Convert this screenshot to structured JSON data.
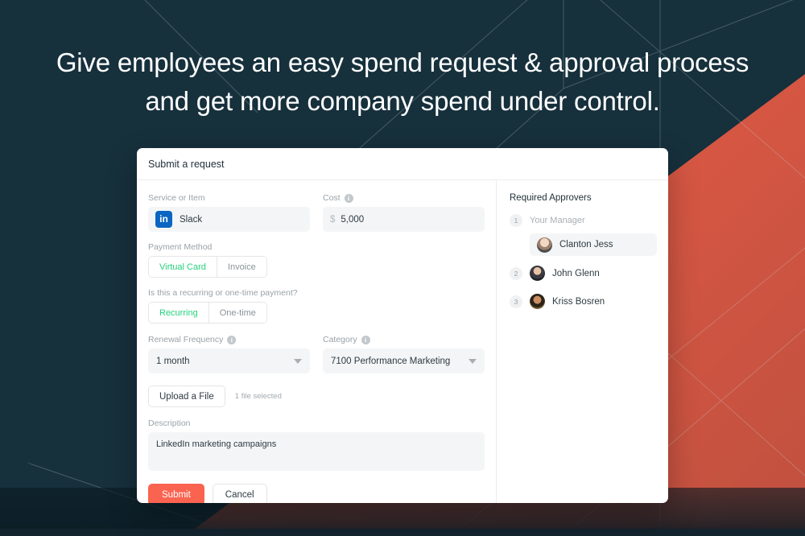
{
  "headline": {
    "line1": "Give employees an easy spend request & approval process",
    "line2": "and get more company spend under control."
  },
  "colors": {
    "background_navy": "#16303c",
    "accent_orange": "#e2573e",
    "submit_button": "#fa6350",
    "active_toggle_text": "#25d07d",
    "linkedin_blue": "#0a66c2"
  },
  "card": {
    "title": "Submit a request",
    "form": {
      "service_or_item": {
        "label": "Service or Item",
        "value": "Slack",
        "icon": "linkedin-icon",
        "icon_text": "in"
      },
      "cost": {
        "label": "Cost",
        "currency_symbol": "$",
        "value": "5,000",
        "info_icon": "info-icon"
      },
      "payment_method": {
        "label": "Payment Method",
        "options": [
          "Virtual Card",
          "Invoice"
        ],
        "selected": "Virtual Card"
      },
      "recurrence": {
        "label": "Is this a recurring or one-time payment?",
        "options": [
          "Recurring",
          "One-time"
        ],
        "selected": "Recurring"
      },
      "renewal_frequency": {
        "label": "Renewal Frequency",
        "value": "1 month",
        "info_icon": "info-icon"
      },
      "category": {
        "label": "Category",
        "value": "7100 Performance Marketing",
        "info_icon": "info-icon"
      },
      "upload": {
        "button_label": "Upload a File",
        "status": "1 file selected"
      },
      "description": {
        "label": "Description",
        "value": "LinkedIn marketing campaigns"
      },
      "actions": {
        "submit_label": "Submit",
        "cancel_label": "Cancel"
      }
    },
    "approvers": {
      "title": "Required Approvers",
      "items": [
        {
          "number": "1",
          "role_label": "Your Manager",
          "name": "Clanton Jess",
          "highlighted": true
        },
        {
          "number": "2",
          "role_label": "",
          "name": "John Glenn",
          "highlighted": false
        },
        {
          "number": "3",
          "role_label": "",
          "name": "Kriss Bosren",
          "highlighted": false
        }
      ]
    }
  }
}
